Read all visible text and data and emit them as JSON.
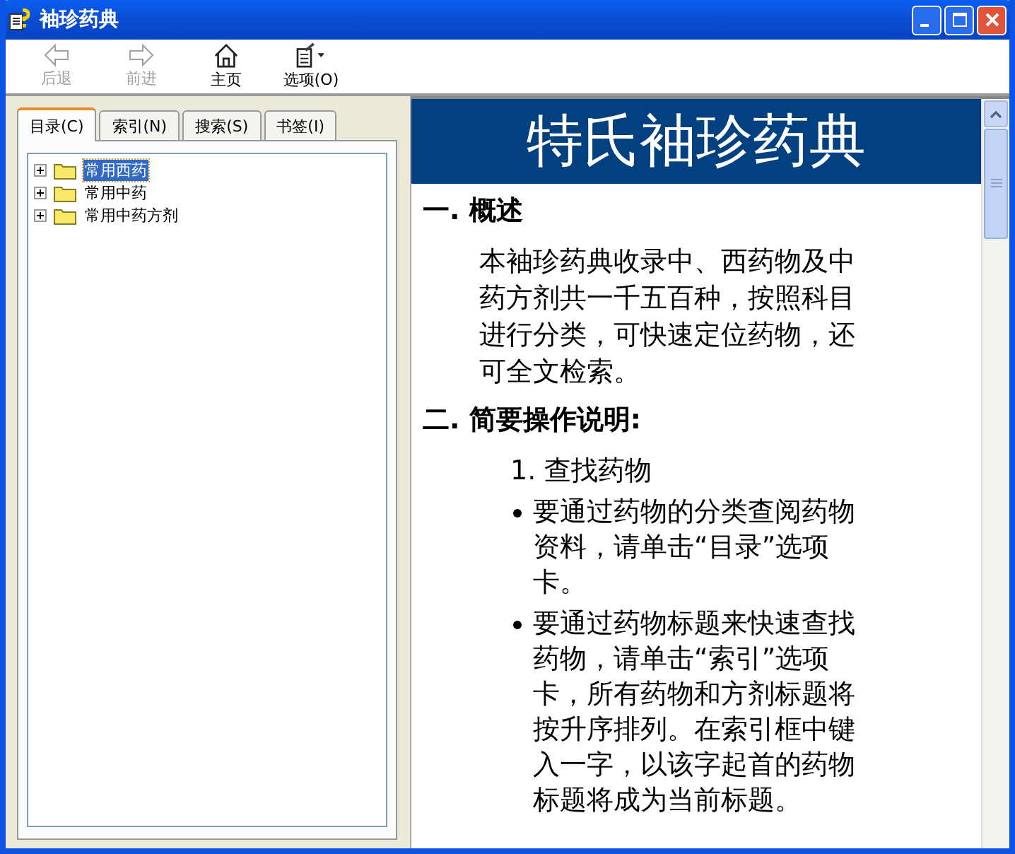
{
  "window": {
    "title": "袖珍药典"
  },
  "toolbar": [
    {
      "kind": "back",
      "label": "后退",
      "disabled": true
    },
    {
      "kind": "forward",
      "label": "前进",
      "disabled": true
    },
    {
      "kind": "home",
      "label": "主页",
      "disabled": false
    },
    {
      "kind": "options",
      "label": "选项(O)",
      "disabled": false
    }
  ],
  "tabs": [
    {
      "label": "目录(C)",
      "selected": true
    },
    {
      "label": "索引(N)",
      "selected": false
    },
    {
      "label": "搜索(S)",
      "selected": false
    },
    {
      "label": "书签(I)",
      "selected": false
    }
  ],
  "tree": [
    {
      "label": "常用西药",
      "selected": true
    },
    {
      "label": "常用中药",
      "selected": false
    },
    {
      "label": "常用中药方剂",
      "selected": false
    }
  ],
  "content": {
    "banner": "特氏袖珍药典",
    "sections": [
      {
        "heading": "一. 概述",
        "blocks": [
          {
            "kind": "paragraph",
            "text": "本袖珍药典收录中、西药物及中药方剂共一千五百种，按照科目进行分类，可快速定位药物，还可全文检索。"
          }
        ]
      },
      {
        "heading": "二. 简要操作说明:",
        "blocks": [
          {
            "kind": "subheading",
            "text": "1. 查找药物"
          },
          {
            "kind": "bullet",
            "text": "要通过药物的分类查阅药物资料，请单击“目录”选项卡。"
          },
          {
            "kind": "bullet",
            "text": "要通过药物标题来快速查找药物，请单击“索引”选项卡，所有药物和方剂标题将按升序排列。在索引框中键入一字，以该字起首的药物标题将成为当前标题。"
          }
        ]
      }
    ]
  }
}
